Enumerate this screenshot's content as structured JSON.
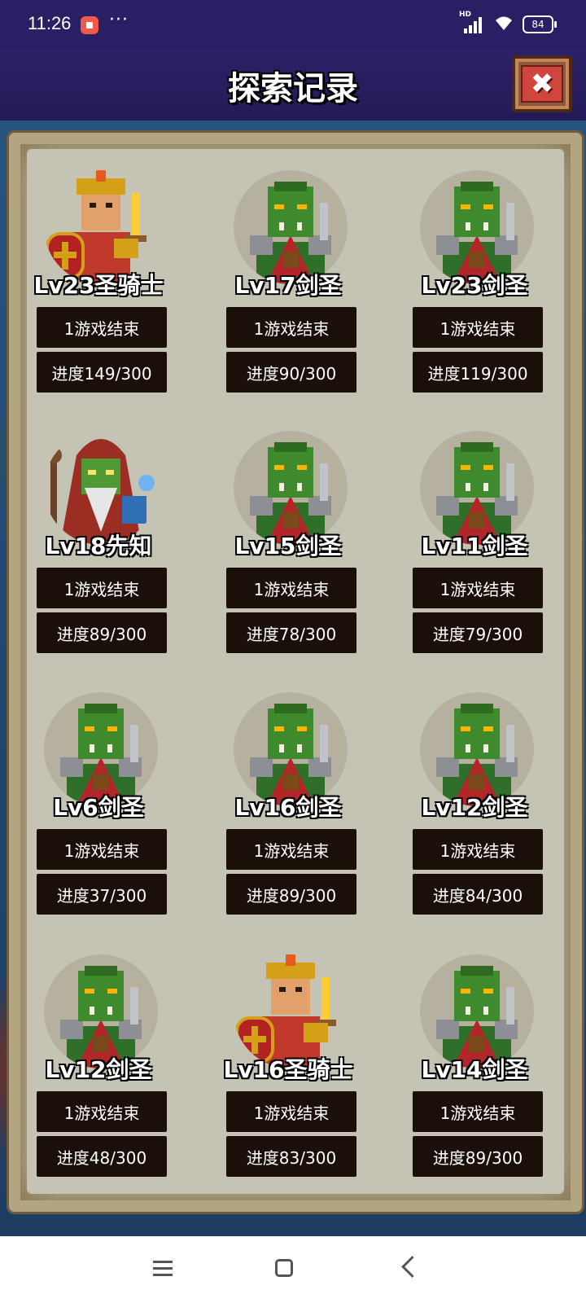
{
  "status_bar": {
    "time": "11:26",
    "dots": "···",
    "network": "HD",
    "battery": "84",
    "icons": [
      "record-icon",
      "signal-icon",
      "wifi-icon",
      "battery-icon"
    ]
  },
  "header": {
    "title": "探索记录",
    "close_icon": "✖"
  },
  "records": [
    {
      "level_name": "Lv23圣骑士",
      "hero": "paladin",
      "status": "1游戏结束",
      "progress": "进度149/300"
    },
    {
      "level_name": "Lv17剑圣",
      "hero": "orc",
      "status": "1游戏结束",
      "progress": "进度90/300"
    },
    {
      "level_name": "Lv23剑圣",
      "hero": "orc",
      "status": "1游戏结束",
      "progress": "进度119/300"
    },
    {
      "level_name": "Lv18先知",
      "hero": "shaman",
      "status": "1游戏结束",
      "progress": "进度89/300"
    },
    {
      "level_name": "Lv15剑圣",
      "hero": "orc",
      "status": "1游戏结束",
      "progress": "进度78/300"
    },
    {
      "level_name": "Lv11剑圣",
      "hero": "orc",
      "status": "1游戏结束",
      "progress": "进度79/300"
    },
    {
      "level_name": "Lv6剑圣",
      "hero": "orc",
      "status": "1游戏结束",
      "progress": "进度37/300"
    },
    {
      "level_name": "Lv16剑圣",
      "hero": "orc",
      "status": "1游戏结束",
      "progress": "进度89/300"
    },
    {
      "level_name": "Lv12剑圣",
      "hero": "orc",
      "status": "1游戏结束",
      "progress": "进度84/300"
    },
    {
      "level_name": "Lv12剑圣",
      "hero": "orc",
      "status": "1游戏结束",
      "progress": "进度48/300"
    },
    {
      "level_name": "Lv16圣骑士",
      "hero": "paladin",
      "status": "1游戏结束",
      "progress": "进度83/300"
    },
    {
      "level_name": "Lv14剑圣",
      "hero": "orc",
      "status": "1游戏结束",
      "progress": "进度89/300"
    }
  ],
  "nav_bar": {
    "icons": [
      "menu-icon",
      "home-icon",
      "back-icon"
    ]
  }
}
